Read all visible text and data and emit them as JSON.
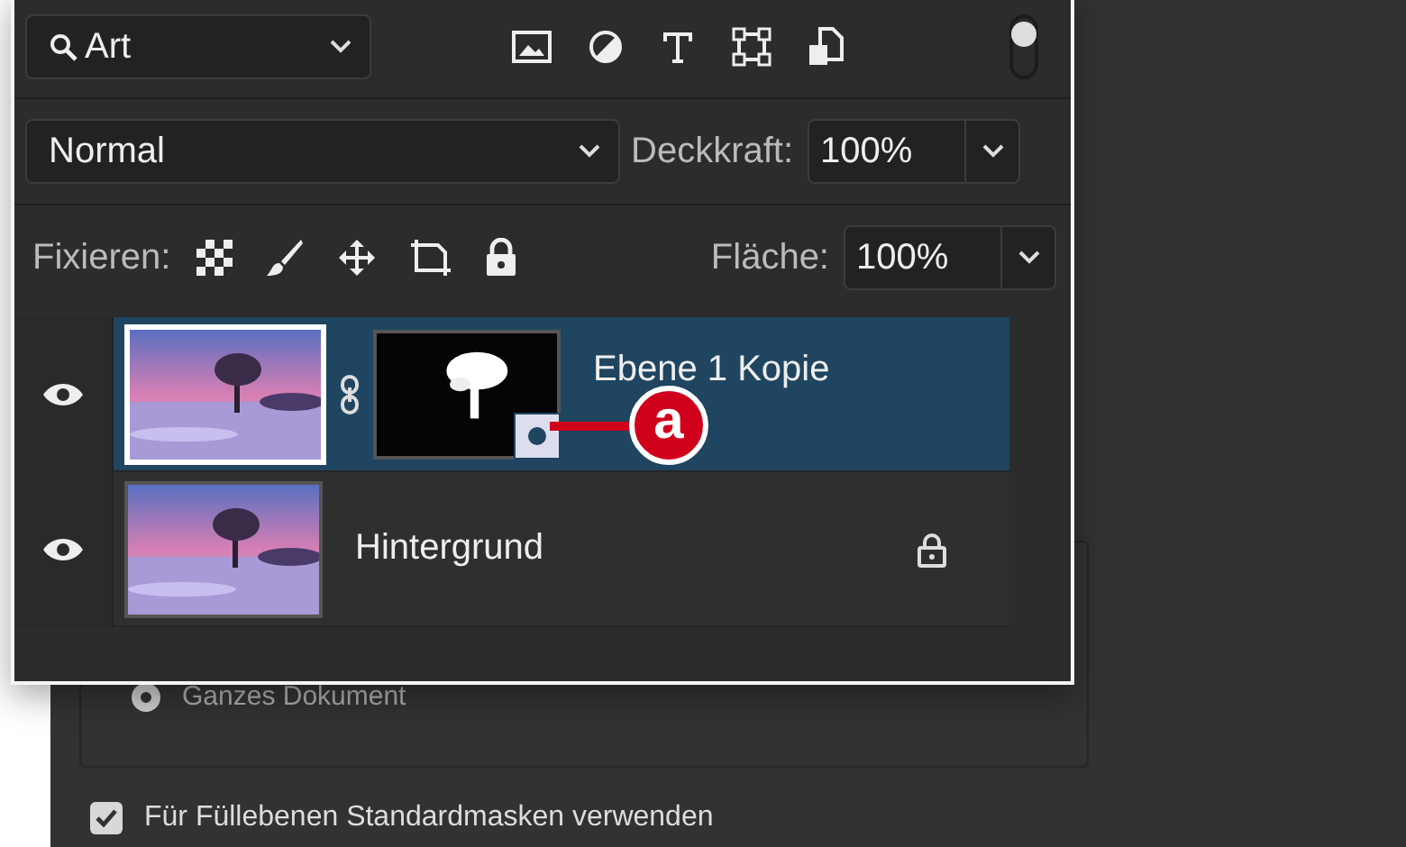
{
  "search": {
    "value": "Art"
  },
  "filter_switch": {
    "on": true
  },
  "blend_mode": {
    "value": "Normal"
  },
  "opacity": {
    "label": "Deckkraft:",
    "value": "100%"
  },
  "lock": {
    "label": "Fixieren:"
  },
  "fill": {
    "label": "Fläche:",
    "value": "100%"
  },
  "layers": [
    {
      "name": "Ebene 1 Kopie",
      "selected": true,
      "visible": true,
      "has_mask": true,
      "locked": false
    },
    {
      "name": "Hintergrund",
      "selected": false,
      "visible": true,
      "has_mask": false,
      "locked": true
    }
  ],
  "callout": {
    "label": "a"
  },
  "background_dialog": {
    "radio": {
      "label": "Ganzes Dokument",
      "selected": true
    },
    "checkbox": {
      "label": "Für Füllebenen Standardmasken verwenden",
      "checked": true
    }
  }
}
